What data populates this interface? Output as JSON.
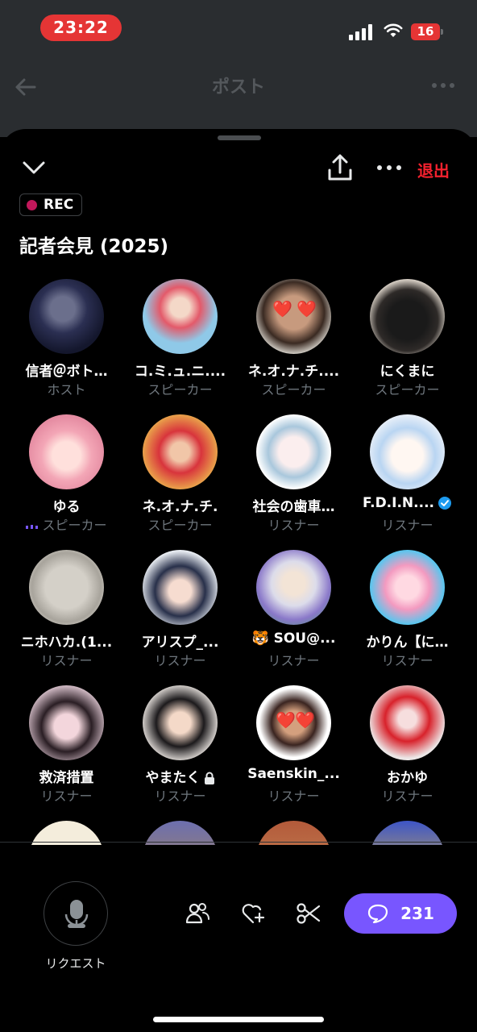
{
  "status_bar": {
    "time": "23:22",
    "battery_level": "16"
  },
  "underlay": {
    "title": "ポスト"
  },
  "sheet": {
    "leave_label": "退出",
    "rec_label": "REC",
    "title": "記者会見 (2025)"
  },
  "participants": [
    {
      "name": "信者＠ボト…",
      "role": "ホスト"
    },
    {
      "name": "コ.ミ.ュ.ニ....",
      "role": "スピーカー"
    },
    {
      "name": "ネ.オ.ナ.チ....",
      "role": "スピーカー"
    },
    {
      "name": "にくまに",
      "role": "スピーカー"
    },
    {
      "name": "ゆる",
      "role": "スピーカー",
      "speaking": true
    },
    {
      "name": "ネ.オ.ナ.チ.",
      "role": "スピーカー"
    },
    {
      "name": "社会の歯車…",
      "role": "リスナー"
    },
    {
      "name": "F.D.I.N....",
      "role": "リスナー",
      "verified": true
    },
    {
      "name": "ニホハカ.(1...",
      "role": "リスナー"
    },
    {
      "name": "アリスプ_...",
      "role": "リスナー"
    },
    {
      "name": "🐯 SOU@...",
      "role": "リスナー"
    },
    {
      "name": "かりん【に…",
      "role": "リスナー"
    },
    {
      "name": "救済措置",
      "role": "リスナー"
    },
    {
      "name": "やまたく",
      "role": "リスナー",
      "locked": true
    },
    {
      "name": "Saenskin_...",
      "role": "リスナー"
    },
    {
      "name": "おかゆ",
      "role": "リスナー"
    }
  ],
  "bottom_bar": {
    "request_label": "リクエスト",
    "comment_count": "231"
  },
  "colors": {
    "accent": "#7856ff",
    "leave": "#f4212e",
    "rec_dot": "#c2185b",
    "verified": "#1d9bf0",
    "time_pill": "#e53535"
  }
}
